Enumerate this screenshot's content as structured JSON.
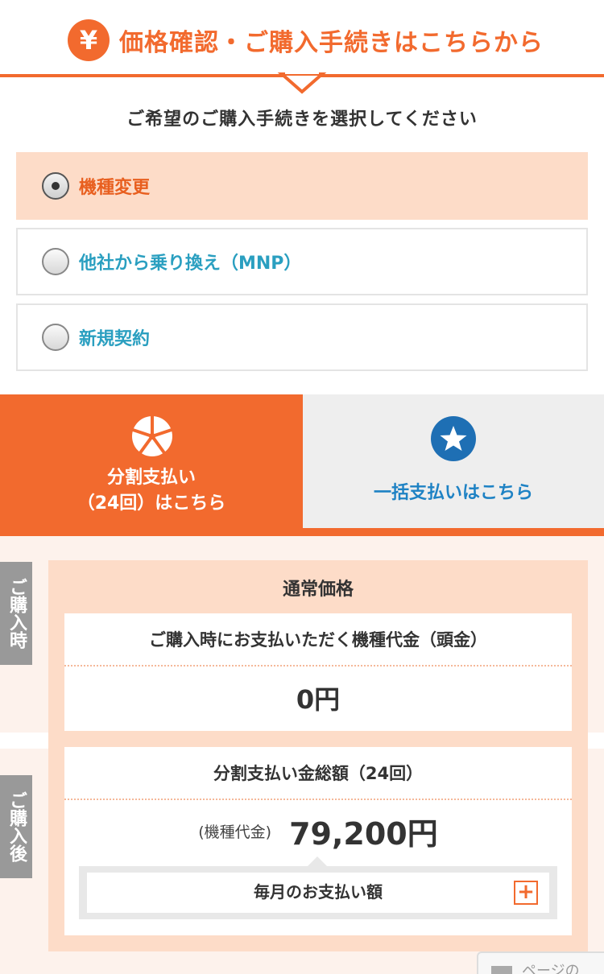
{
  "header": {
    "icon": "yen-icon",
    "title": "価格確認・ご購入手続きはこちらから",
    "accent": "#f26a2e"
  },
  "instruction": "ご希望のご購入手続きを選択してください",
  "options": [
    {
      "label": "機種変更",
      "selected": true
    },
    {
      "label": "他社から乗り換え（MNP）",
      "selected": false
    },
    {
      "label": "新規契約",
      "selected": false
    }
  ],
  "tabs": {
    "installment": {
      "icon": "pie-chart-icon",
      "line1": "分割支払い",
      "line2": "（24回）はこちら",
      "active": true
    },
    "lump_sum": {
      "icon": "star-icon",
      "label": "一括支払いはこちら",
      "active": false
    }
  },
  "side_labels": {
    "at_purchase": "ご購入時",
    "after_purchase": "ご購入後"
  },
  "price": {
    "heading": "通常価格",
    "down_payment_label": "ご購入時にお支払いただく機種代金（頭金）",
    "down_payment_value": "0円",
    "installment_total_label": "分割支払い金総額（24回）",
    "model_note": "(機種代金)",
    "installment_total_value": "79,200円",
    "monthly_label": "毎月のお支払い額",
    "expand_icon": "plus-icon"
  },
  "page_top": {
    "label": "ページの"
  }
}
